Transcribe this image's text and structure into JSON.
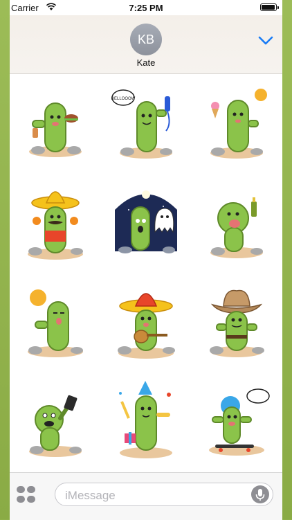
{
  "status_bar": {
    "carrier": "Carrier",
    "time": "7:25 PM",
    "battery_level": 0.95,
    "wifi_icon": "wifi-icon"
  },
  "contact": {
    "initials": "KB",
    "name": "Kate"
  },
  "header": {
    "collapse_icon": "chevron-down-icon",
    "accent_color": "#1a7cf5"
  },
  "stickers": [
    {
      "name": "sticker-cactus-burger"
    },
    {
      "name": "sticker-cactus-phone-hellooow",
      "bubble": "HELLOOOW"
    },
    {
      "name": "sticker-cactus-icecream-sun"
    },
    {
      "name": "sticker-cactus-sombrero-maracas"
    },
    {
      "name": "sticker-cactus-night-ghost"
    },
    {
      "name": "sticker-cactus-drinking"
    },
    {
      "name": "sticker-cactus-sun-sleepy"
    },
    {
      "name": "sticker-cactus-sombrero-guitar"
    },
    {
      "name": "sticker-cactus-cowboy"
    },
    {
      "name": "sticker-cactus-selfie"
    },
    {
      "name": "sticker-cactus-party"
    },
    {
      "name": "sticker-cactus-skateboard"
    }
  ],
  "composer": {
    "placeholder": "iMessage"
  },
  "colors": {
    "frame": "#8fb04a",
    "cactus": "#8bc34a",
    "cactus_dark": "#6fa032"
  }
}
